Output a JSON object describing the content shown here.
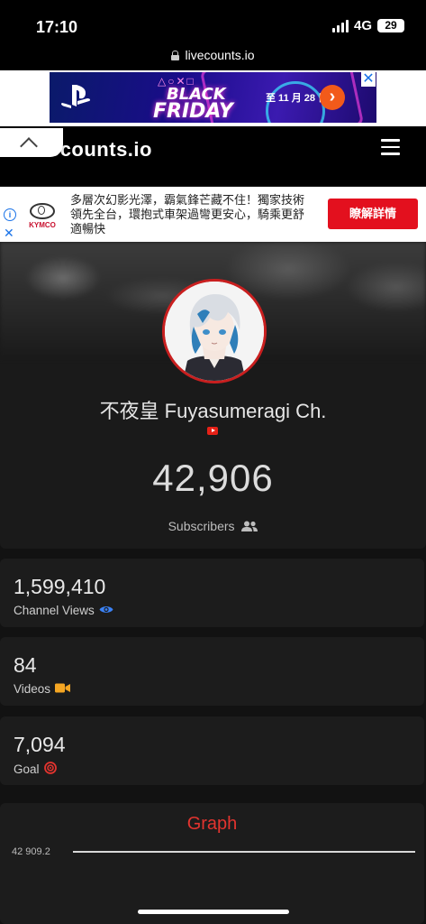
{
  "status": {
    "time": "17:10",
    "network": "4G",
    "battery": "29"
  },
  "browser": {
    "url": "livecounts.io"
  },
  "top_ad": {
    "symbols": "△○✕□",
    "line1": "BLACK",
    "line2": "FRIDAY",
    "date": "至 11 月 28 日",
    "arrow": "›",
    "close": "✕"
  },
  "header": {
    "logo": "livecounts.io"
  },
  "kymco_ad": {
    "brand": "KYMCO",
    "copy": "多層次幻影光澤，霸氣鋒芒藏不住！獨家技術領先全台，環抱式車架過彎更安心，騎乘更舒適暢快",
    "cta": "瞭解詳情",
    "info": "i",
    "close": "✕"
  },
  "profile": {
    "channel_name": "不夜皇 Fuyasumeragi Ch.",
    "subscriber_count": "42,906",
    "subscriber_label": "Subscribers"
  },
  "stats": [
    {
      "value": "1,599,410",
      "label": "Channel Views",
      "icon": "eye-icon",
      "icon_color": "#3b82f6"
    },
    {
      "value": "84",
      "label": "Videos",
      "icon": "video-camera-icon",
      "icon_color": "#f5a623"
    },
    {
      "value": "7,094",
      "label": "Goal",
      "icon": "target-icon",
      "icon_color": "#e3342f"
    }
  ],
  "graph": {
    "title": "Graph",
    "y_tick": "42 909.2"
  },
  "colors": {
    "accent_red": "#e3342f",
    "background": "#121212",
    "card": "#1c1c1c"
  }
}
